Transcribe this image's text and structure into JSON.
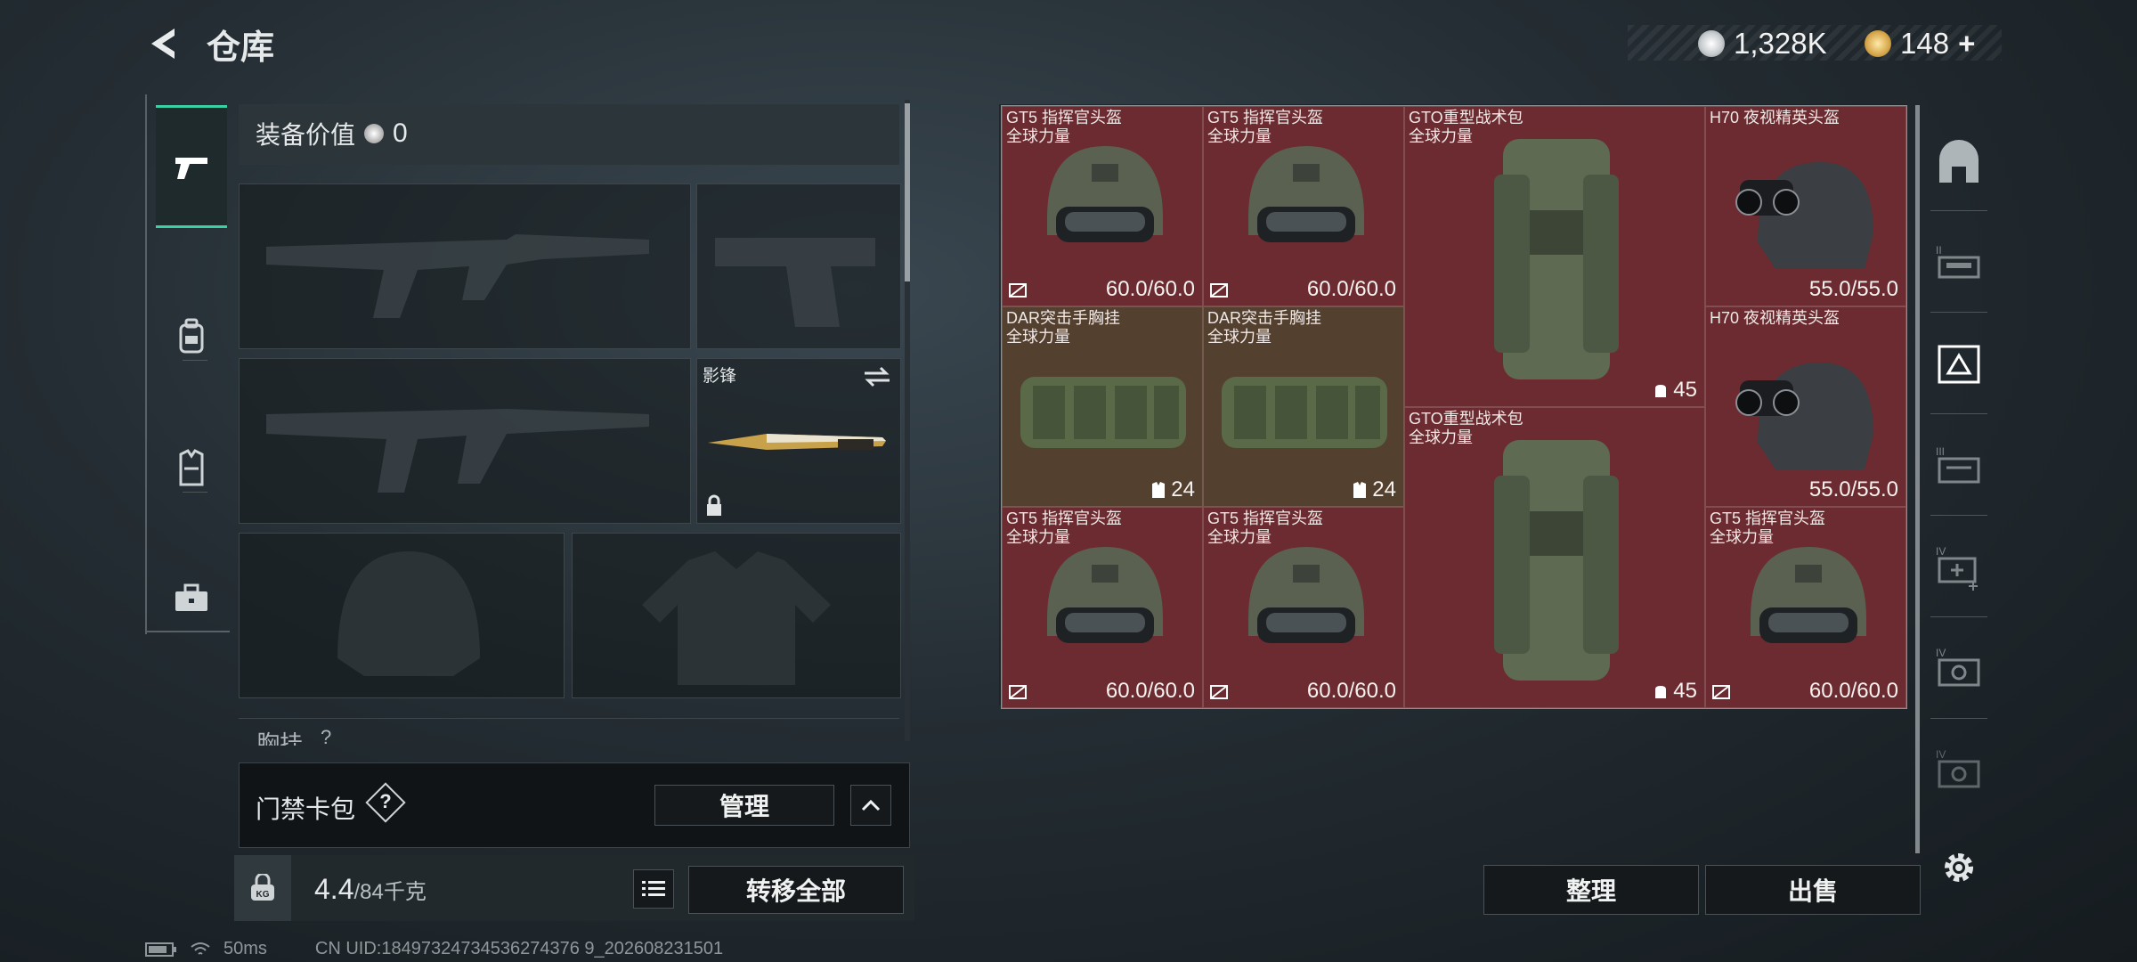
{
  "header": {
    "title": "仓库",
    "currency1": "1,328K",
    "currency2": "148",
    "currency2_plus": "+"
  },
  "equipment": {
    "value_label": "装备价值",
    "value": "0",
    "melee_name": "影锋",
    "chest_rig_label": "胸挂",
    "chest_rig_count": "?"
  },
  "keycard": {
    "label": "门禁卡包",
    "help": "?",
    "manage_button": "管理"
  },
  "weight": {
    "current": "4.4",
    "max": "/84千克",
    "transfer_button": "转移全部"
  },
  "stash": {
    "items": [
      {
        "name": "GT5 指挥官头盔",
        "sub": "全球力量",
        "value": "60.0/60.0"
      },
      {
        "name": "GT5 指挥官头盔",
        "sub": "全球力量",
        "value": "60.0/60.0"
      },
      {
        "name": "GTO重型战术包",
        "sub": "全球力量",
        "value": "45"
      },
      {
        "name": "H70 夜视精英头盔",
        "sub": "",
        "value": "55.0/55.0"
      },
      {
        "name": "DAR突击手胸挂",
        "sub": "全球力量",
        "value": "24"
      },
      {
        "name": "DAR突击手胸挂",
        "sub": "全球力量",
        "value": "24"
      },
      {
        "name": "H70 夜视精英头盔",
        "sub": "",
        "value": "55.0/55.0"
      },
      {
        "name": "GTO重型战术包",
        "sub": "全球力量",
        "value": "45"
      },
      {
        "name": "GT5 指挥官头盔",
        "sub": "全球力量",
        "value": "60.0/60.0"
      },
      {
        "name": "GT5 指挥官头盔",
        "sub": "全球力量",
        "value": "60.0/60.0"
      },
      {
        "name": "GT5 指挥官头盔",
        "sub": "全球力量",
        "value": "60.0/60.0"
      }
    ],
    "sort_button": "整理",
    "sell_button": "出售"
  },
  "status": {
    "ping": "50ms",
    "uid": "CN UID:18497324734536274376 9_202608231501"
  },
  "colors": {
    "accent": "#3ad0a6",
    "item_bg_red": "#6b2b30",
    "item_bg_brown": "#53402f"
  }
}
